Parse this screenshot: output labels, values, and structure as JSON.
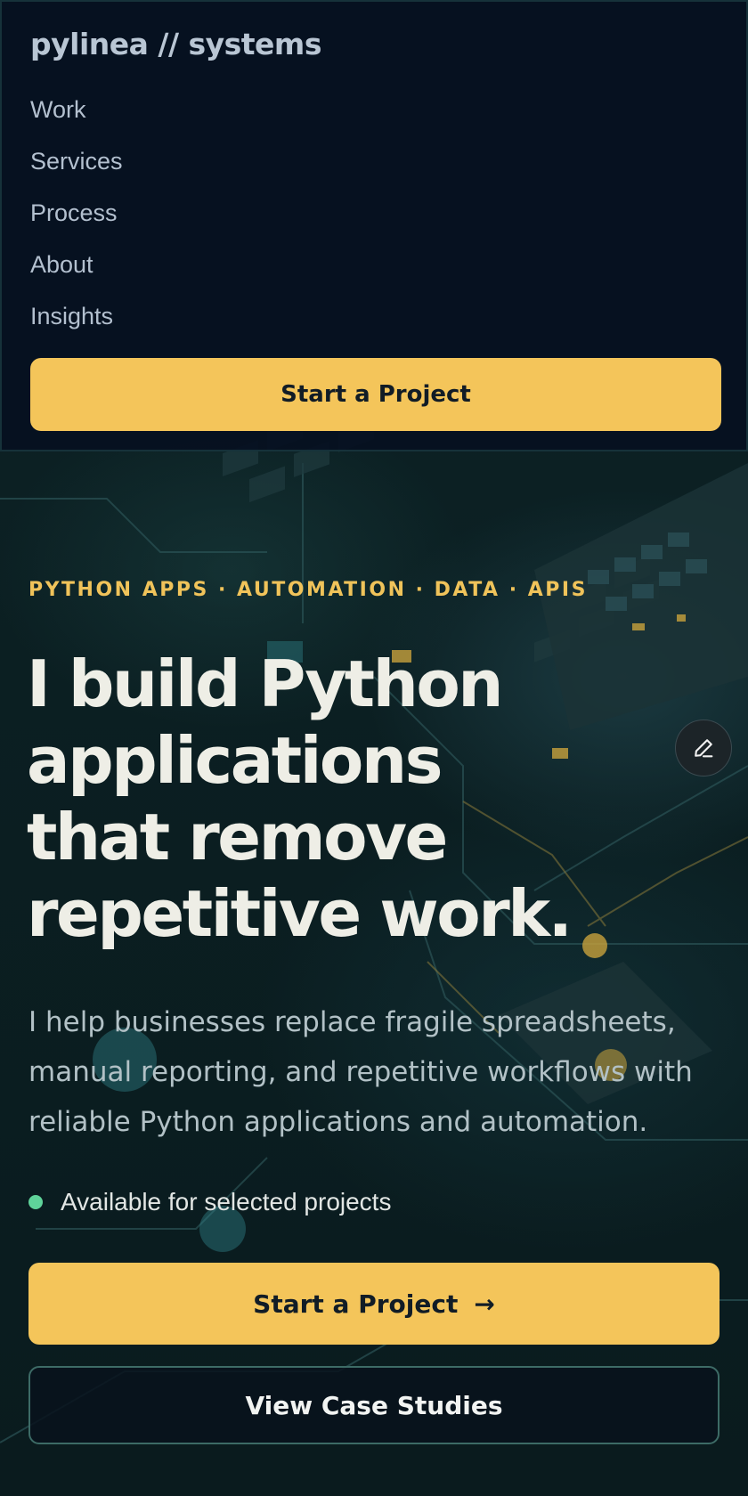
{
  "colors": {
    "accent": "#f4c55a",
    "nav_background": "#061020",
    "hero_background": "#0b1f22",
    "status_available": "#5fd39a",
    "headline": "#eeeee6",
    "eyebrow": "#f0c35a"
  },
  "nav": {
    "brand": "pylinea // systems",
    "items": [
      {
        "label": "Work"
      },
      {
        "label": "Services"
      },
      {
        "label": "Process"
      },
      {
        "label": "About"
      },
      {
        "label": "Insights"
      }
    ],
    "cta_label": "Start a Project"
  },
  "hero": {
    "eyebrow": "PYTHON APPS · AUTOMATION · DATA · APIS",
    "headline_lines": [
      "I build Python",
      "applications",
      "that remove",
      "repetitive work."
    ],
    "lede_lines": [
      "I help businesses replace fragile spreadsheets,",
      "manual reporting, and repetitive workflows with",
      "reliable Python applications and automation."
    ],
    "availability": "Available for selected projects",
    "primary_cta_label": "Start a Project",
    "primary_cta_icon": "arrow-right-icon",
    "primary_cta_arrow": "→",
    "secondary_cta_label": "View Case Studies",
    "edit_icon": "pencil-icon"
  }
}
